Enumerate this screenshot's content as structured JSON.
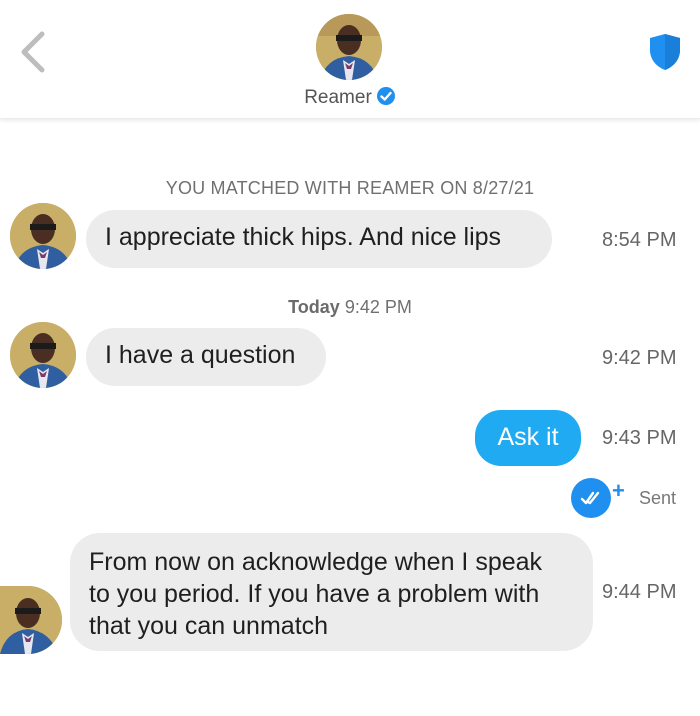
{
  "header": {
    "contact_name": "Reamer",
    "back_icon": "chevron-left-icon",
    "safety_icon": "shield-icon",
    "verified_icon": "verified-check-icon",
    "accent_color": "#1f8ff0"
  },
  "thread": {
    "match_notice": "YOU MATCHED WITH REAMER ON 8/27/21",
    "today_label": "Today",
    "today_time": "9:42 PM",
    "messages": [
      {
        "from": "Reamer",
        "text": "I appreciate thick hips. And nice lips",
        "time": "8:54 PM"
      },
      {
        "from": "Reamer",
        "text": "I have a question",
        "time": "9:42 PM"
      },
      {
        "from": "me",
        "text": "Ask it",
        "time": "9:43 PM"
      },
      {
        "from": "Reamer",
        "lines": [
          "From now on acknowledge when I speak",
          "to you period. If you have a problem with",
          "that you can unmatch"
        ],
        "time": "9:44 PM"
      }
    ],
    "receipt": {
      "status": "Sent",
      "plus": "+"
    }
  },
  "colors": {
    "outgoing_bubble": "#1faaf2",
    "incoming_bubble": "#ececed"
  }
}
